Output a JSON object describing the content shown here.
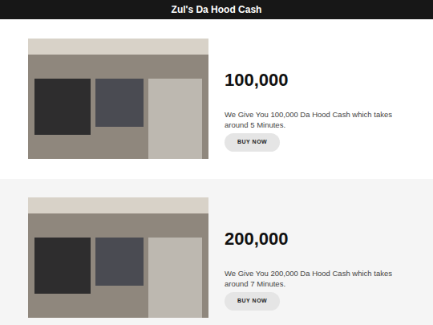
{
  "header": {
    "title": "Zul's Da Hood Cash"
  },
  "products": [
    {
      "amount": "100,000",
      "description": "We Give You 100,000 Da Hood Cash which takes around 5 Minutes.",
      "button": "BUY NOW"
    },
    {
      "amount": "200,000",
      "description": "We Give You 200,000 Da Hood Cash which takes around 7 Minutes.",
      "button": "BUY NOW"
    }
  ]
}
